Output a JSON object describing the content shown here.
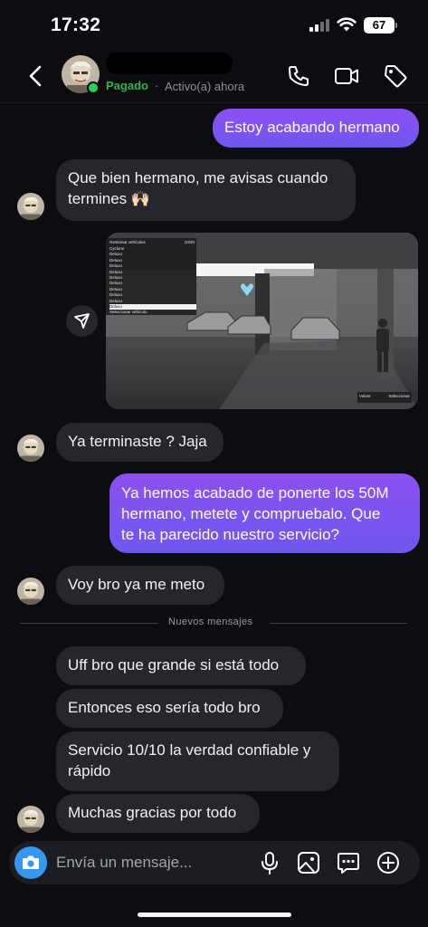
{
  "status_bar": {
    "time": "17:32",
    "battery": "67"
  },
  "header": {
    "paid_label": "Pagado",
    "separator": "·",
    "status": "Activo(a) ahora"
  },
  "messages": [
    {
      "dir": "out",
      "text": "Estoy acabando hermano"
    },
    {
      "dir": "in",
      "text": "Que bien hermano, me avisas cuando\ntermines 🙌🏻"
    },
    {
      "dir": "out",
      "text": "Ya hemos acabado de ponerte los 50M\nhermano, metete y compruebalo. Que\nte ha parecido nuestro servicio?"
    },
    {
      "dir": "in",
      "text": "Ya terminaste ? Jaja"
    },
    {
      "dir": "in",
      "text": "Voy bro ya me meto"
    },
    {
      "dir": "in",
      "text": "Uff bro que grande si está todo"
    },
    {
      "dir": "in",
      "text": "Entonces eso sería todo bro"
    },
    {
      "dir": "in",
      "text": "Servicio 10/10 la verdad confiable y\nrápido"
    },
    {
      "dir": "in",
      "text": "Muchas gracias por todo"
    }
  ],
  "image_menu": {
    "title": "Gestionar vehículos",
    "counter": "10/20",
    "items": [
      "Cyclone",
      "Deluxo",
      "Deluxo",
      "Deluxo",
      "Deluxo",
      "Deluxo",
      "Deluxo",
      "Deluxo",
      "Deluxo",
      "Deluxo",
      "Deluxo"
    ],
    "footer": "Seleccionar vehículo",
    "hint_left": "Volver",
    "hint_right": "Seleccionar"
  },
  "divider_text": "Nuevos mensajes",
  "composer": {
    "placeholder": "Envía un mensaje..."
  },
  "colors": {
    "accent_blue": "#3797f0",
    "online_green": "#2bd05b",
    "bubble_in": "#26272c",
    "bubble_out": "#7a55ef"
  },
  "icons": [
    "back-icon",
    "phone-icon",
    "video-icon",
    "tag-icon",
    "share-icon",
    "camera-icon",
    "mic-icon",
    "gallery-icon",
    "sticker-icon",
    "plus-icon"
  ]
}
